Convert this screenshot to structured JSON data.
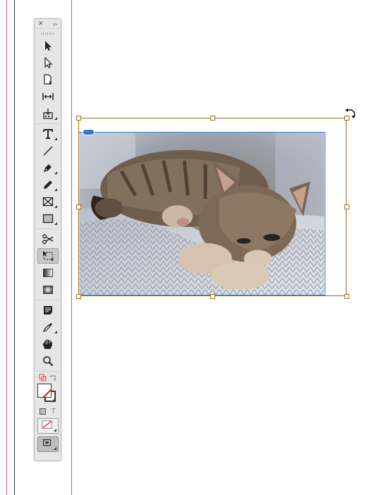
{
  "window": {
    "panel_close_icon": "close-icon",
    "panel_collapse_icon": "double-chevron-icon"
  },
  "tools": [
    {
      "name": "selection-tool",
      "icon": "arrow-icon"
    },
    {
      "name": "direct-selection-tool",
      "icon": "hollow-arrow-icon"
    },
    {
      "name": "page-tool",
      "icon": "page-icon"
    },
    {
      "name": "gap-tool",
      "icon": "gap-icon"
    },
    {
      "name": "content-collector-tool",
      "icon": "collector-icon"
    },
    {
      "name": "type-tool",
      "icon": "type-icon"
    },
    {
      "name": "line-tool",
      "icon": "line-icon"
    },
    {
      "name": "pen-tool",
      "icon": "pen-icon"
    },
    {
      "name": "pencil-tool",
      "icon": "pencil-icon"
    },
    {
      "name": "rectangle-frame-tool",
      "icon": "frame-x-icon"
    },
    {
      "name": "rectangle-tool",
      "icon": "rectangle-icon"
    },
    {
      "name": "scissors-tool",
      "icon": "scissors-icon"
    },
    {
      "name": "free-transform-tool",
      "icon": "free-transform-icon",
      "active": true
    },
    {
      "name": "gradient-swatch-tool",
      "icon": "gradient-icon"
    },
    {
      "name": "gradient-feather-tool",
      "icon": "gradient-feather-icon"
    },
    {
      "name": "note-tool",
      "icon": "note-icon"
    },
    {
      "name": "eyedropper-tool",
      "icon": "eyedropper-icon"
    },
    {
      "name": "hand-tool",
      "icon": "hand-icon"
    },
    {
      "name": "zoom-tool",
      "icon": "zoom-icon"
    }
  ],
  "colors": {
    "frame_border": "#a06c1a",
    "content_border": "#3d86d6",
    "none_swatch_slash": "#e2141c"
  },
  "canvas": {
    "image_description_icon": "kitten-photo",
    "link_badge_icon": "link-icon",
    "rotate_cursor_icon": "rotate-icon"
  }
}
